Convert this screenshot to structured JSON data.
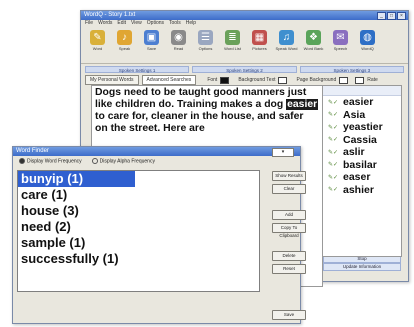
{
  "main_window": {
    "title": "WordQ - Story 1.txt",
    "controls": [
      "_",
      "□",
      "×"
    ],
    "menu": [
      "File",
      "Words",
      "Edit",
      "View",
      "Options",
      "Tools",
      "Help"
    ],
    "toolbar": [
      {
        "label": "Word",
        "icon": "pencil-icon",
        "color": "#d9b03a"
      },
      {
        "label": "Speak",
        "icon": "speaker-icon",
        "color": "#e0a632"
      },
      {
        "label": "Save",
        "icon": "save-icon",
        "color": "#4d7fd1"
      },
      {
        "label": "Read",
        "icon": "read-icon",
        "color": "#8a8a8a"
      },
      {
        "label": "Options",
        "icon": "options-icon",
        "color": "#9aa7c0"
      },
      {
        "label": "Word List",
        "icon": "word-list-icon",
        "color": "#6aa15a"
      },
      {
        "label": "Pictures",
        "icon": "pictures-icon",
        "color": "#c0504d"
      },
      {
        "label": "Speak Word",
        "icon": "speak-word-icon",
        "color": "#3f8fcf"
      },
      {
        "label": "Word Bank",
        "icon": "word-bank-icon",
        "color": "#5aa45a"
      },
      {
        "label": "Speech",
        "icon": "speech-icon",
        "color": "#8a6fbf"
      },
      {
        "label": "WordQ",
        "icon": "globe-icon",
        "color": "#2e6fc6"
      }
    ],
    "groups": [
      "Spoken Settings 1",
      "Spoken Settings 2",
      "Spoken Settings 3"
    ],
    "tabs": [
      "My Personal Words",
      "Advanced Searches"
    ],
    "font_label": "Font",
    "bg_label": "Background Text",
    "page_bg_label": "Page Background",
    "check_label": "Rate"
  },
  "document": {
    "before": "Dogs need to be taught good manners just like children do. Training makes a dog ",
    "highlight": "easier",
    "after": " to care for, cleaner in the house, and safer on the street. Here are"
  },
  "suggestions": [
    "easier",
    "Asia",
    "yeastier",
    "Cassia",
    "aslir",
    "basilar",
    "easer",
    "ashier"
  ],
  "suggestion_marks": "✎✓",
  "main_status": [
    "Stop",
    "Update Information"
  ],
  "dialog": {
    "title": "Word Finder",
    "radio_options": [
      "Display Word Frequency",
      "Display Alpha Frequency"
    ],
    "list": [
      "bunyip (1)",
      "care (1)",
      "house (3)",
      "need (2)",
      "sample (1)",
      "successfully (1)"
    ],
    "buttons": [
      "Show Results",
      "Clear",
      "Add",
      "Copy To Clipboard",
      "Delete",
      "Reset",
      "Save"
    ],
    "dropdown": "▾"
  }
}
